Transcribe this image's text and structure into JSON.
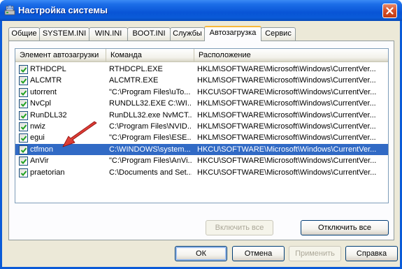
{
  "window": {
    "title": "Настройка системы"
  },
  "tabs": [
    {
      "label": "Общие",
      "active": false
    },
    {
      "label": "SYSTEM.INI",
      "active": false
    },
    {
      "label": "WIN.INI",
      "active": false
    },
    {
      "label": "BOOT.INI",
      "active": false
    },
    {
      "label": "Службы",
      "active": false
    },
    {
      "label": "Автозагрузка",
      "active": true
    },
    {
      "label": "Сервис",
      "active": false
    }
  ],
  "startup_list": {
    "columns": [
      "Элемент автозагрузки",
      "Команда",
      "Расположение"
    ],
    "rows": [
      {
        "name": "RTHDCPL",
        "command": "RTHDCPL.EXE",
        "location": "HKLM\\SOFTWARE\\Microsoft\\Windows\\CurrentVer...",
        "checked": true,
        "selected": false
      },
      {
        "name": "ALCMTR",
        "command": "ALCMTR.EXE",
        "location": "HKLM\\SOFTWARE\\Microsoft\\Windows\\CurrentVer...",
        "checked": true,
        "selected": false
      },
      {
        "name": "utorrent",
        "command": "\"C:\\Program Files\\uTo...",
        "location": "HKCU\\SOFTWARE\\Microsoft\\Windows\\CurrentVer...",
        "checked": true,
        "selected": false
      },
      {
        "name": "NvCpl",
        "command": "RUNDLL32.EXE C:\\WI...",
        "location": "HKLM\\SOFTWARE\\Microsoft\\Windows\\CurrentVer...",
        "checked": true,
        "selected": false
      },
      {
        "name": "RunDLL32",
        "command": "RunDLL32.exe NvMCT...",
        "location": "HKLM\\SOFTWARE\\Microsoft\\Windows\\CurrentVer...",
        "checked": true,
        "selected": false
      },
      {
        "name": "nwiz",
        "command": "C:\\Program Files\\NVID...",
        "location": "HKLM\\SOFTWARE\\Microsoft\\Windows\\CurrentVer...",
        "checked": true,
        "selected": false
      },
      {
        "name": "egui",
        "command": "\"C:\\Program Files\\ESE...",
        "location": "HKLM\\SOFTWARE\\Microsoft\\Windows\\CurrentVer...",
        "checked": true,
        "selected": false
      },
      {
        "name": "ctfmon",
        "command": "C:\\WINDOWS\\system...",
        "location": "HKCU\\SOFTWARE\\Microsoft\\Windows\\CurrentVer...",
        "checked": true,
        "selected": true
      },
      {
        "name": "AnVir",
        "command": "\"C:\\Program Files\\AnVi...",
        "location": "HKCU\\SOFTWARE\\Microsoft\\Windows\\CurrentVer...",
        "checked": true,
        "selected": false
      },
      {
        "name": "praetorian",
        "command": "C:\\Documents and Set...",
        "location": "HKCU\\SOFTWARE\\Microsoft\\Windows\\CurrentVer...",
        "checked": true,
        "selected": false
      }
    ]
  },
  "panel_buttons": {
    "enable_all": "Включить все",
    "disable_all": "Отключить все"
  },
  "dialog_buttons": {
    "ok": "ОК",
    "cancel": "Отмена",
    "apply": "Применить",
    "help": "Справка"
  },
  "colors": {
    "titlebar": "#0a5bd8",
    "selection": "#316ac5",
    "annotation_arrow": "#e01a1a"
  }
}
